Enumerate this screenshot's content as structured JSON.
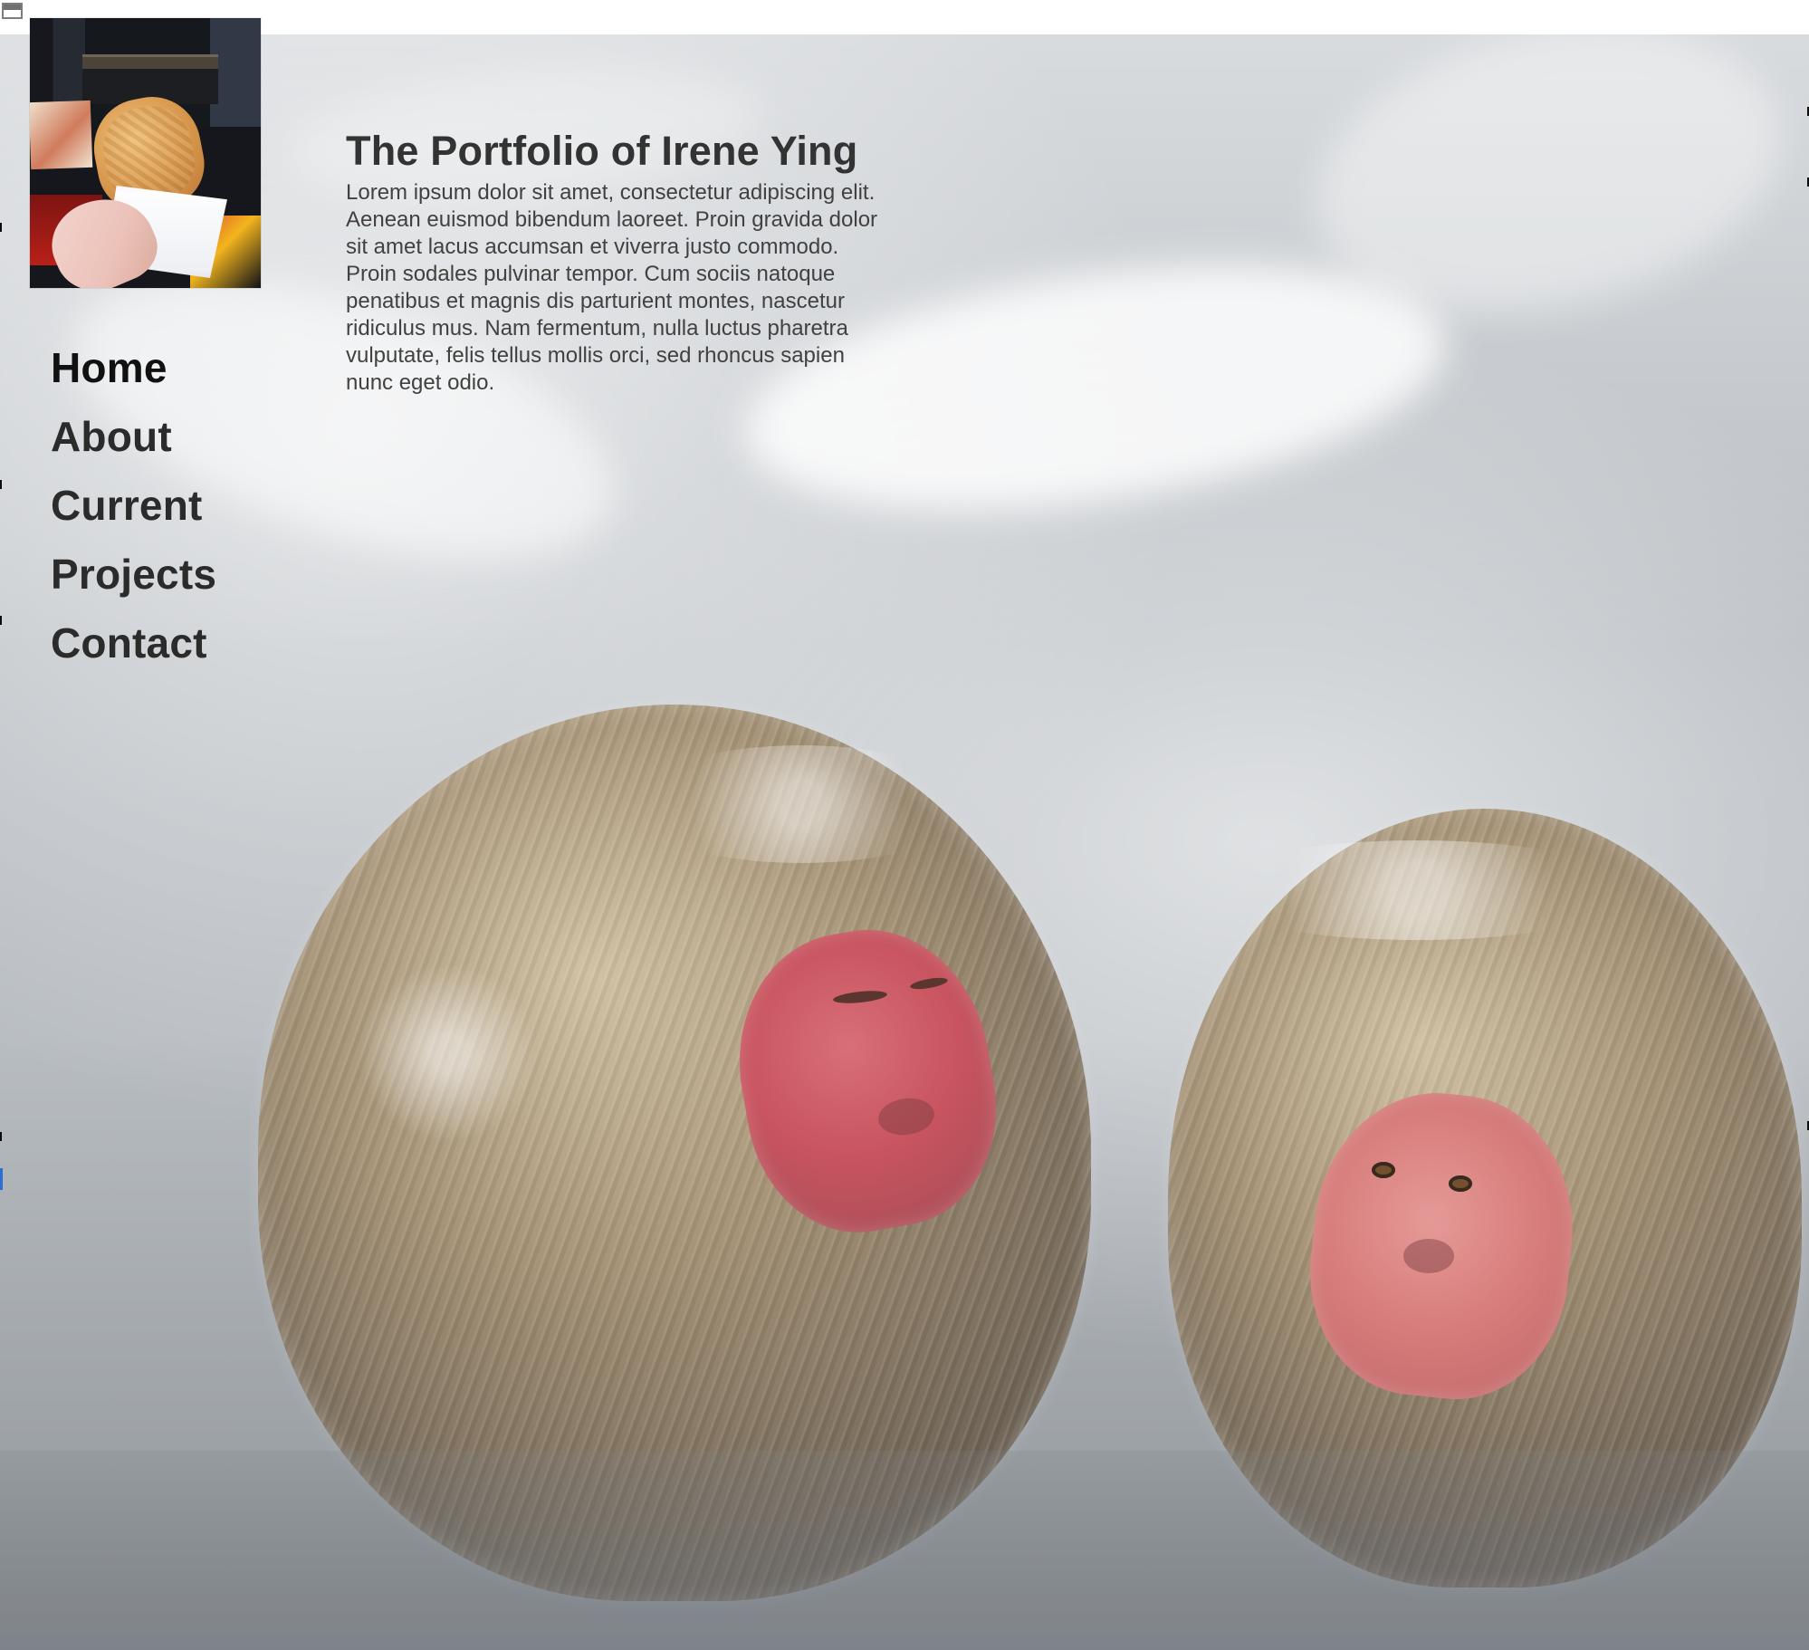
{
  "site": {
    "title": "The Portfolio of Irene Ying",
    "intro": "Lorem ipsum dolor sit amet, consectetur adipiscing elit. Aenean euismod bibendum laoreet. Proin gravida dolor sit amet lacus accumsan et viverra justo commodo. Proin sodales pulvinar tempor. Cum sociis natoque penatibus et magnis dis parturient montes, nascetur ridiculus mus. Nam fermentum, nulla luctus pharetra vulputate, felis tellus mollis orci, sed rhoncus sapien nunc eget odio."
  },
  "nav": {
    "items": [
      {
        "label": "Home"
      },
      {
        "label": "About"
      },
      {
        "label": "Current"
      },
      {
        "label": "Projects"
      },
      {
        "label": "Contact"
      }
    ]
  },
  "media": {
    "profile_image": "taiyaki-photo",
    "hero_image": "snow-monkeys-photo"
  },
  "colors": {
    "nav_text": "#2b2b2b",
    "heading_text": "#333333",
    "body_text": "#414141",
    "page_bg": "#ffffff"
  }
}
